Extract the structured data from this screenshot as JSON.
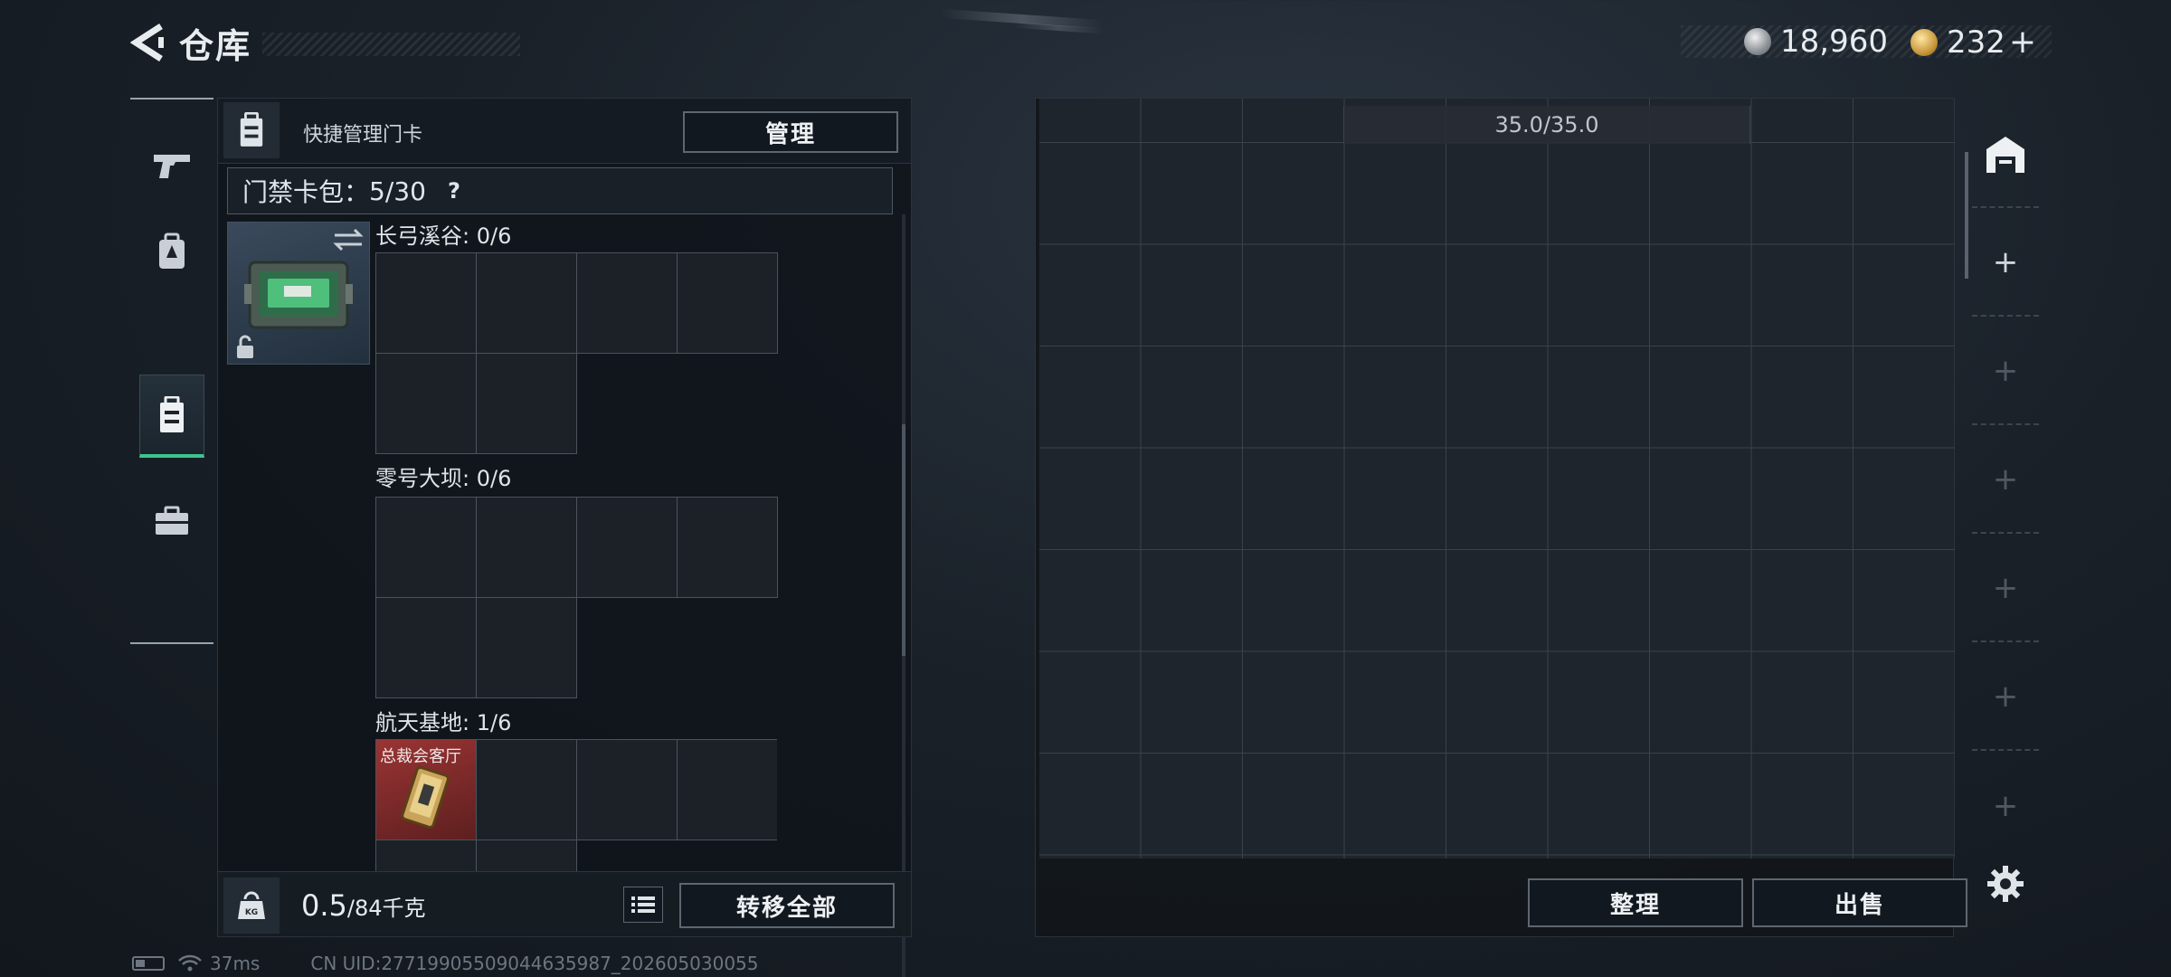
{
  "header": {
    "title": "仓库",
    "currency_silver": "18,960",
    "currency_gold": "232",
    "plus": "+"
  },
  "left_nav": {
    "items": [
      "weapon-icon",
      "backpack-icon",
      "keycard-case-icon",
      "briefcase-icon"
    ],
    "active_index": 2
  },
  "left_panel": {
    "head_label": "快捷管理门卡",
    "manage_button": "管理",
    "capacity_label": "门禁卡包：",
    "capacity_value": "5/30",
    "help": "?",
    "sections": [
      {
        "label": "长弓溪谷: 0/6",
        "items": []
      },
      {
        "label": "零号大坝: 0/6",
        "items": []
      },
      {
        "label": "航天基地: 1/6",
        "items": [
          {
            "name": "总裁会客厅",
            "slot": 0
          }
        ]
      }
    ],
    "weight_current": "0.5",
    "weight_max": "/84千克",
    "kg_badge": "KG",
    "transfer_all_button": "转移全部"
  },
  "right_panel": {
    "capacity": "35.0/35.0",
    "sort_button": "整理",
    "sell_button": "出售"
  },
  "side_tools": {
    "plus": "+"
  },
  "status": {
    "ping": "37ms",
    "uid": "CN UID:27719905509044635987_202605030055"
  },
  "colors": {
    "accent": "#3ec48f",
    "item_red": "#8a2a2a"
  }
}
